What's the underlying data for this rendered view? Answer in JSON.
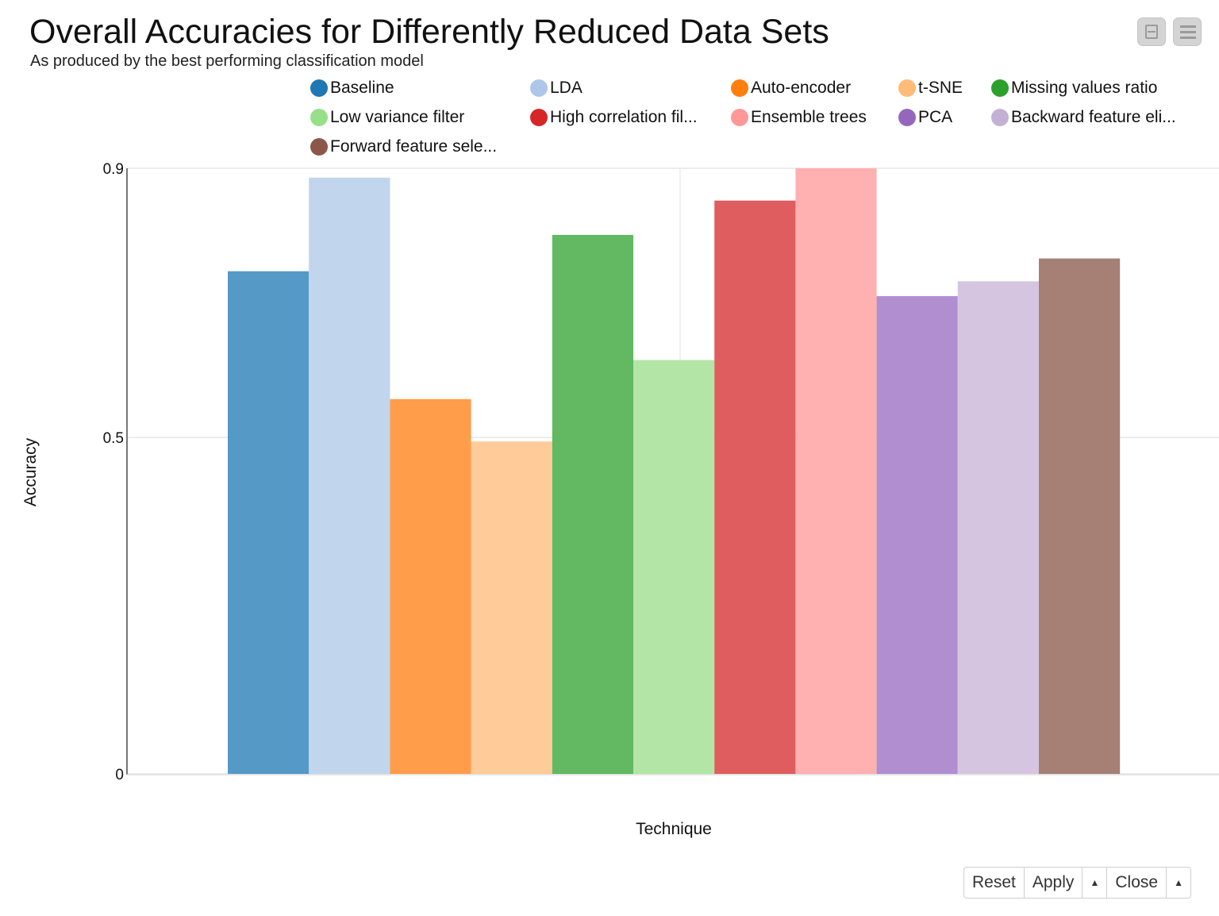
{
  "header": {
    "title": "Overall Accuracies for Differently Reduced Data Sets",
    "subtitle": "As produced by the best performing classification model"
  },
  "controls": {
    "layout_button": "layout-toggle",
    "menu_button": "menu"
  },
  "legend": [
    {
      "label": "Baseline",
      "color": "#1f77b4"
    },
    {
      "label": "LDA",
      "color": "#aec7e8"
    },
    {
      "label": "Auto-encoder",
      "color": "#ff7f0e"
    },
    {
      "label": "t-SNE",
      "color": "#ffbb78"
    },
    {
      "label": "Missing values ratio",
      "color": "#2ca02c"
    },
    {
      "label": "Low variance filter",
      "color": "#98df8a"
    },
    {
      "label": "High correlation fil...",
      "color": "#d62728"
    },
    {
      "label": "Ensemble trees",
      "color": "#ff9896"
    },
    {
      "label": "PCA",
      "color": "#9467bd"
    },
    {
      "label": "Backward feature eli...",
      "color": "#c5b0d5"
    },
    {
      "label": "Forward feature sele...",
      "color": "#8c564b"
    }
  ],
  "chart_data": {
    "type": "bar",
    "title": "Overall Accuracies for Differently Reduced Data Sets",
    "subtitle": "As produced by the best performing classification model",
    "xlabel": "Technique",
    "ylabel": "Accuracy",
    "ylim": [
      0,
      0.9
    ],
    "yticks": [
      0,
      0.5,
      0.9
    ],
    "ytick_labels": [
      "0",
      "0.5",
      "0.9"
    ],
    "grid": true,
    "legend_position": "top",
    "series": [
      {
        "name": "Baseline",
        "value": 0.747,
        "color": "#5599c7"
      },
      {
        "name": "LDA",
        "value": 0.886,
        "color": "#c1d5ed"
      },
      {
        "name": "Auto-encoder",
        "value": 0.557,
        "color": "#ff9d4a"
      },
      {
        "name": "t-SNE",
        "value": 0.494,
        "color": "#ffcb99"
      },
      {
        "name": "Missing values ratio",
        "value": 0.801,
        "color": "#63b862"
      },
      {
        "name": "Low variance filter",
        "value": 0.615,
        "color": "#b3e6a6"
      },
      {
        "name": "High correlation filter",
        "value": 0.852,
        "color": "#df5d5e"
      },
      {
        "name": "Ensemble trees",
        "value": 0.9,
        "color": "#ffb0b0"
      },
      {
        "name": "PCA",
        "value": 0.71,
        "color": "#b08ed0"
      },
      {
        "name": "Backward feature elimination",
        "value": 0.732,
        "color": "#d6c5e1"
      },
      {
        "name": "Forward feature selection",
        "value": 0.766,
        "color": "#a67f75"
      }
    ]
  },
  "footer": {
    "reset_label": "Reset",
    "apply_label": "Apply",
    "close_label": "Close",
    "caret": "▲"
  }
}
